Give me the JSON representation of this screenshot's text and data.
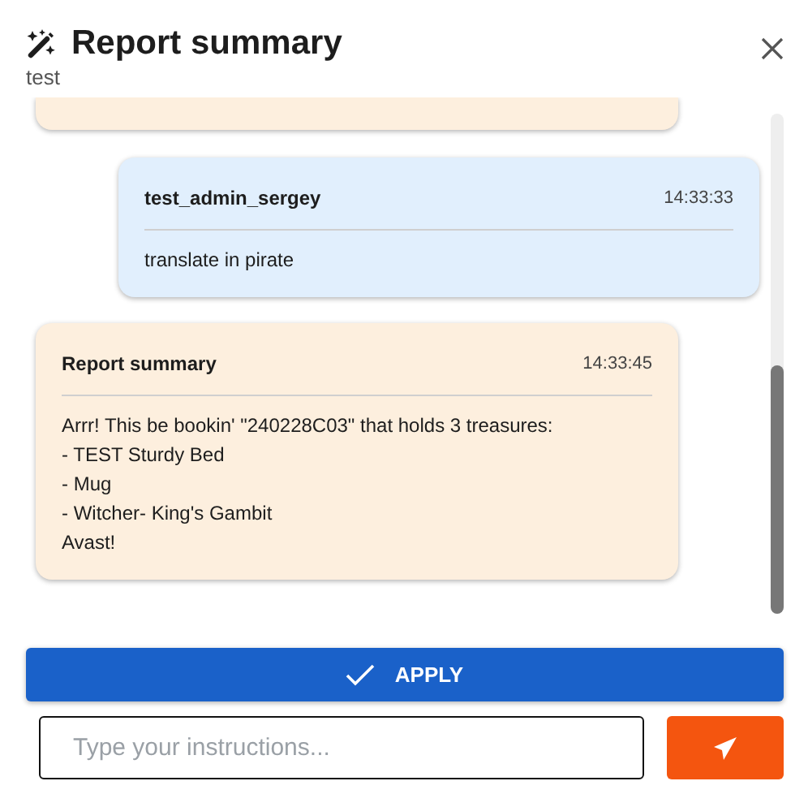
{
  "dialog": {
    "title": "Report summary",
    "subtitle": "test"
  },
  "messages": [
    {
      "kind": "assistant",
      "clipped": true
    },
    {
      "kind": "user",
      "clipped": false,
      "author": "test_admin_sergey",
      "time": "14:33:33",
      "text": "translate in pirate"
    },
    {
      "kind": "assistant",
      "clipped": false,
      "author": "Report summary",
      "time": "14:33:45",
      "text": "Arrr! This be bookin' \"240228C03\" that holds 3 treasures:\n- TEST Sturdy Bed\n- Mug\n- Witcher- King's Gambit\nAvast!"
    }
  ],
  "apply_button": "APPLY",
  "input": {
    "placeholder": "Type your instructions..."
  }
}
